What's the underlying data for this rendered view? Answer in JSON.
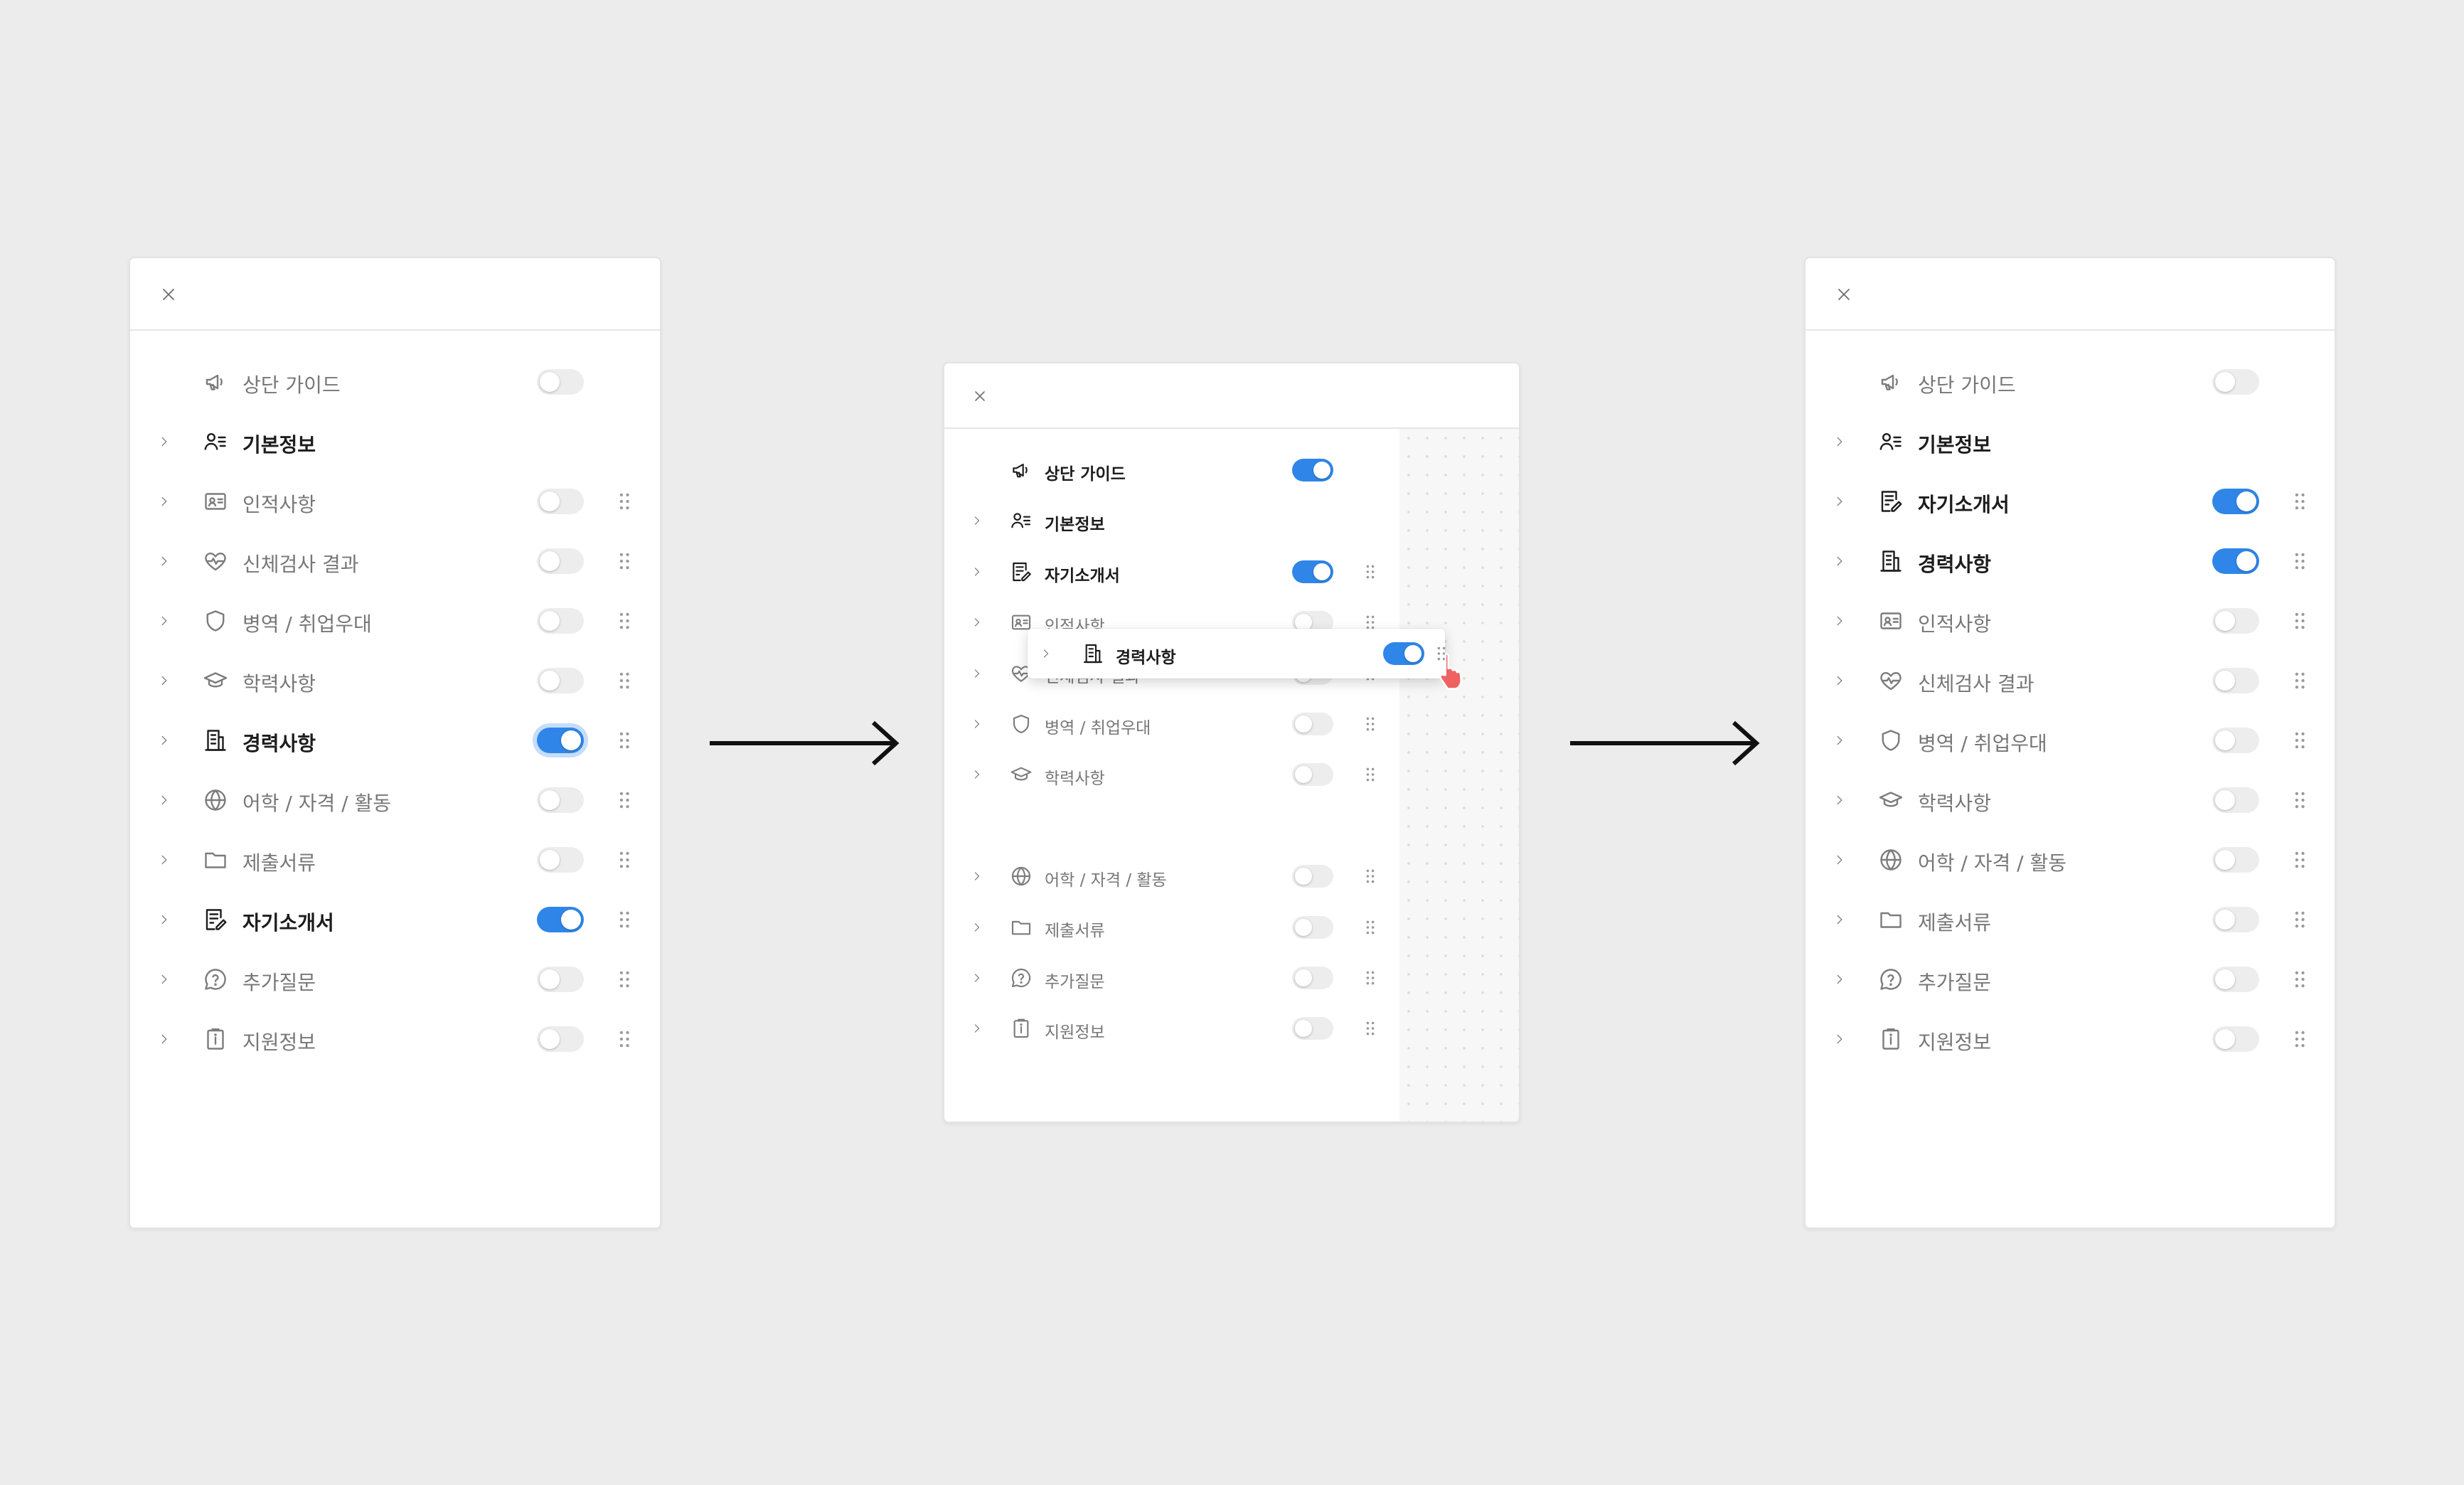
{
  "colors": {
    "accent": "#2f86e8",
    "background": "#ececec",
    "cursor": "#f06161"
  },
  "icons": {
    "close": "x-icon",
    "expand": "chevron-right-icon",
    "drag": "drag-handle-icon"
  },
  "steps": [
    {
      "id": "before",
      "items": [
        {
          "label": "상단 가이드",
          "icon": "megaphone-icon",
          "toggle": false,
          "chevron": false,
          "grip": false
        },
        {
          "label": "기본정보",
          "icon": "person-list-icon",
          "toggle": null,
          "chevron": true,
          "grip": false,
          "bold": true
        },
        {
          "label": "인적사항",
          "icon": "id-card-icon",
          "toggle": false,
          "chevron": true,
          "grip": true
        },
        {
          "label": "신체검사 결과",
          "icon": "heart-pulse-icon",
          "toggle": false,
          "chevron": true,
          "grip": true
        },
        {
          "label": "병역 / 취업우대",
          "icon": "shield-icon",
          "toggle": false,
          "chevron": true,
          "grip": true
        },
        {
          "label": "학력사항",
          "icon": "graduation-cap-icon",
          "toggle": false,
          "chevron": true,
          "grip": true
        },
        {
          "label": "경력사항",
          "icon": "building-icon",
          "toggle": true,
          "chevron": true,
          "grip": true,
          "focus": true
        },
        {
          "label": "어학 / 자격 / 활동",
          "icon": "globe-icon",
          "toggle": false,
          "chevron": true,
          "grip": true
        },
        {
          "label": "제출서류",
          "icon": "folder-icon",
          "toggle": false,
          "chevron": true,
          "grip": true
        },
        {
          "label": "자기소개서",
          "icon": "document-edit-icon",
          "toggle": true,
          "chevron": true,
          "grip": true
        },
        {
          "label": "추가질문",
          "icon": "question-bubble-icon",
          "toggle": false,
          "chevron": true,
          "grip": true
        },
        {
          "label": "지원정보",
          "icon": "info-clipboard-icon",
          "toggle": false,
          "chevron": true,
          "grip": true
        }
      ]
    },
    {
      "id": "dragging",
      "items": [
        {
          "label": "상단 가이드",
          "icon": "megaphone-icon",
          "toggle": true,
          "chevron": false,
          "grip": false,
          "bold": true
        },
        {
          "label": "기본정보",
          "icon": "person-list-icon",
          "toggle": null,
          "chevron": true,
          "grip": false,
          "bold": true
        },
        {
          "label": "자기소개서",
          "icon": "document-edit-icon",
          "toggle": true,
          "chevron": true,
          "grip": true
        },
        {
          "label": "인적사항",
          "icon": "id-card-icon",
          "toggle": false,
          "chevron": true,
          "grip": true
        },
        {
          "label": "신체검사 결과",
          "icon": "heart-pulse-icon",
          "toggle": false,
          "chevron": true,
          "grip": true
        },
        {
          "label": "병역 / 취업우대",
          "icon": "shield-icon",
          "toggle": false,
          "chevron": true,
          "grip": true
        },
        {
          "label": "학력사항",
          "icon": "graduation-cap-icon",
          "toggle": false,
          "chevron": true,
          "grip": true
        },
        {
          "label": "",
          "icon": "",
          "toggle": null,
          "chevron": false,
          "grip": false,
          "gap": true
        },
        {
          "label": "어학 / 자격 / 활동",
          "icon": "globe-icon",
          "toggle": false,
          "chevron": true,
          "grip": true
        },
        {
          "label": "제출서류",
          "icon": "folder-icon",
          "toggle": false,
          "chevron": true,
          "grip": true
        },
        {
          "label": "추가질문",
          "icon": "question-bubble-icon",
          "toggle": false,
          "chevron": true,
          "grip": true
        },
        {
          "label": "지원정보",
          "icon": "info-clipboard-icon",
          "toggle": false,
          "chevron": true,
          "grip": true
        }
      ],
      "dragged": {
        "label": "경력사항",
        "icon": "building-icon",
        "toggle": true
      }
    },
    {
      "id": "after",
      "items": [
        {
          "label": "상단 가이드",
          "icon": "megaphone-icon",
          "toggle": false,
          "chevron": false,
          "grip": false
        },
        {
          "label": "기본정보",
          "icon": "person-list-icon",
          "toggle": null,
          "chevron": true,
          "grip": false,
          "bold": true
        },
        {
          "label": "자기소개서",
          "icon": "document-edit-icon",
          "toggle": true,
          "chevron": true,
          "grip": true
        },
        {
          "label": "경력사항",
          "icon": "building-icon",
          "toggle": true,
          "chevron": true,
          "grip": true
        },
        {
          "label": "인적사항",
          "icon": "id-card-icon",
          "toggle": false,
          "chevron": true,
          "grip": true
        },
        {
          "label": "신체검사 결과",
          "icon": "heart-pulse-icon",
          "toggle": false,
          "chevron": true,
          "grip": true
        },
        {
          "label": "병역 / 취업우대",
          "icon": "shield-icon",
          "toggle": false,
          "chevron": true,
          "grip": true
        },
        {
          "label": "학력사항",
          "icon": "graduation-cap-icon",
          "toggle": false,
          "chevron": true,
          "grip": true
        },
        {
          "label": "어학 / 자격 / 활동",
          "icon": "globe-icon",
          "toggle": false,
          "chevron": true,
          "grip": true
        },
        {
          "label": "제출서류",
          "icon": "folder-icon",
          "toggle": false,
          "chevron": true,
          "grip": true
        },
        {
          "label": "추가질문",
          "icon": "question-bubble-icon",
          "toggle": false,
          "chevron": true,
          "grip": true
        },
        {
          "label": "지원정보",
          "icon": "info-clipboard-icon",
          "toggle": false,
          "chevron": true,
          "grip": true
        }
      ]
    }
  ]
}
